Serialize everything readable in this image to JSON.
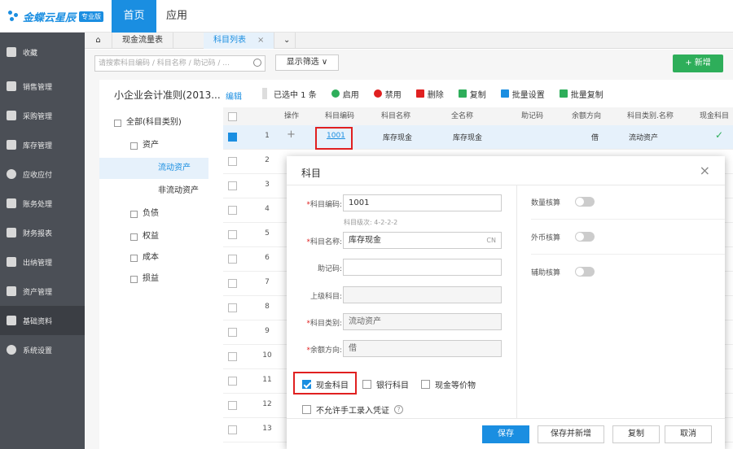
{
  "app": {
    "brand": "金蝶云星辰",
    "edition_badge": "专业版",
    "nav": [
      "首页",
      "应用"
    ]
  },
  "sidebar": {
    "items": [
      {
        "label": "收藏",
        "icon": "star-icon"
      },
      {
        "label": "销售管理",
        "icon": "bar-chart-icon"
      },
      {
        "label": "采购管理",
        "icon": "cart-icon"
      },
      {
        "label": "库存管理",
        "icon": "box-icon"
      },
      {
        "label": "应收应付",
        "icon": "coin-icon"
      },
      {
        "label": "账务处理",
        "icon": "ledger-icon"
      },
      {
        "label": "财务报表",
        "icon": "report-icon"
      },
      {
        "label": "出纳管理",
        "icon": "cashier-icon"
      },
      {
        "label": "资产管理",
        "icon": "asset-icon"
      },
      {
        "label": "基础资料",
        "icon": "layers-icon"
      },
      {
        "label": "系统设置",
        "icon": "gear-icon"
      }
    ]
  },
  "tabs": [
    {
      "label": "现金流量表"
    },
    {
      "label": "科目列表"
    }
  ],
  "search": {
    "placeholder": "请搜索科目编码 / 科目名称 / 助记码 / ..."
  },
  "filter_label": "显示筛选 ∨",
  "add_label": "+ 新增",
  "ledger": {
    "name": "小企业会计准则(2013...",
    "edit": "编辑"
  },
  "toolbar": {
    "selected": "已选中 1 条",
    "items": [
      "启用",
      "禁用",
      "删除",
      "复制",
      "批量设置",
      "批量复制"
    ]
  },
  "tree": [
    {
      "label": "全部(科目类别)"
    },
    {
      "label": "资产"
    },
    {
      "label": "流动资产"
    },
    {
      "label": "非流动资产"
    },
    {
      "label": "负债"
    },
    {
      "label": "权益"
    },
    {
      "label": "成本"
    },
    {
      "label": "损益"
    }
  ],
  "table": {
    "headers": [
      "操作",
      "科目编码",
      "科目名称",
      "全名称",
      "助记码",
      "余额方向",
      "科目类别.名称",
      "现金科目"
    ],
    "first_row": {
      "num": "1",
      "op": "+",
      "code": "1001",
      "name": "库存现金",
      "fullname": "库存现金",
      "direction": "借",
      "category": "流动资产",
      "cash": "✓"
    },
    "row_nums": [
      "2",
      "3",
      "4",
      "5",
      "6",
      "7",
      "8",
      "9",
      "10",
      "11",
      "12",
      "13"
    ]
  },
  "modal": {
    "title": "科目",
    "close": "×",
    "fields": {
      "code_label": "科目编码:",
      "code_value": "1001",
      "level_hint": "科目级次: 4-2-2-2",
      "name_label": "科目名称:",
      "name_value": "库存现金",
      "name_lang": "CN",
      "mnemonic_label": "助记码:",
      "mnemonic_value": "",
      "parent_label": "上级科目:",
      "parent_value": "",
      "category_label": "科目类别:",
      "category_value": "流动资产",
      "direction_label": "余额方向:",
      "direction_value": "借"
    },
    "toggles": [
      {
        "label": "数量核算",
        "on": false
      },
      {
        "label": "外币核算",
        "on": false
      },
      {
        "label": "辅助核算",
        "on": false
      }
    ],
    "checkboxes": [
      {
        "label": "现金科目",
        "checked": true
      },
      {
        "label": "银行科目",
        "checked": false
      },
      {
        "label": "现金等价物",
        "checked": false
      },
      {
        "label": "不允许手工录入凭证",
        "checked": false
      }
    ],
    "help": "?",
    "buttons": [
      "保存",
      "保存并新增",
      "复制",
      "取消"
    ]
  }
}
